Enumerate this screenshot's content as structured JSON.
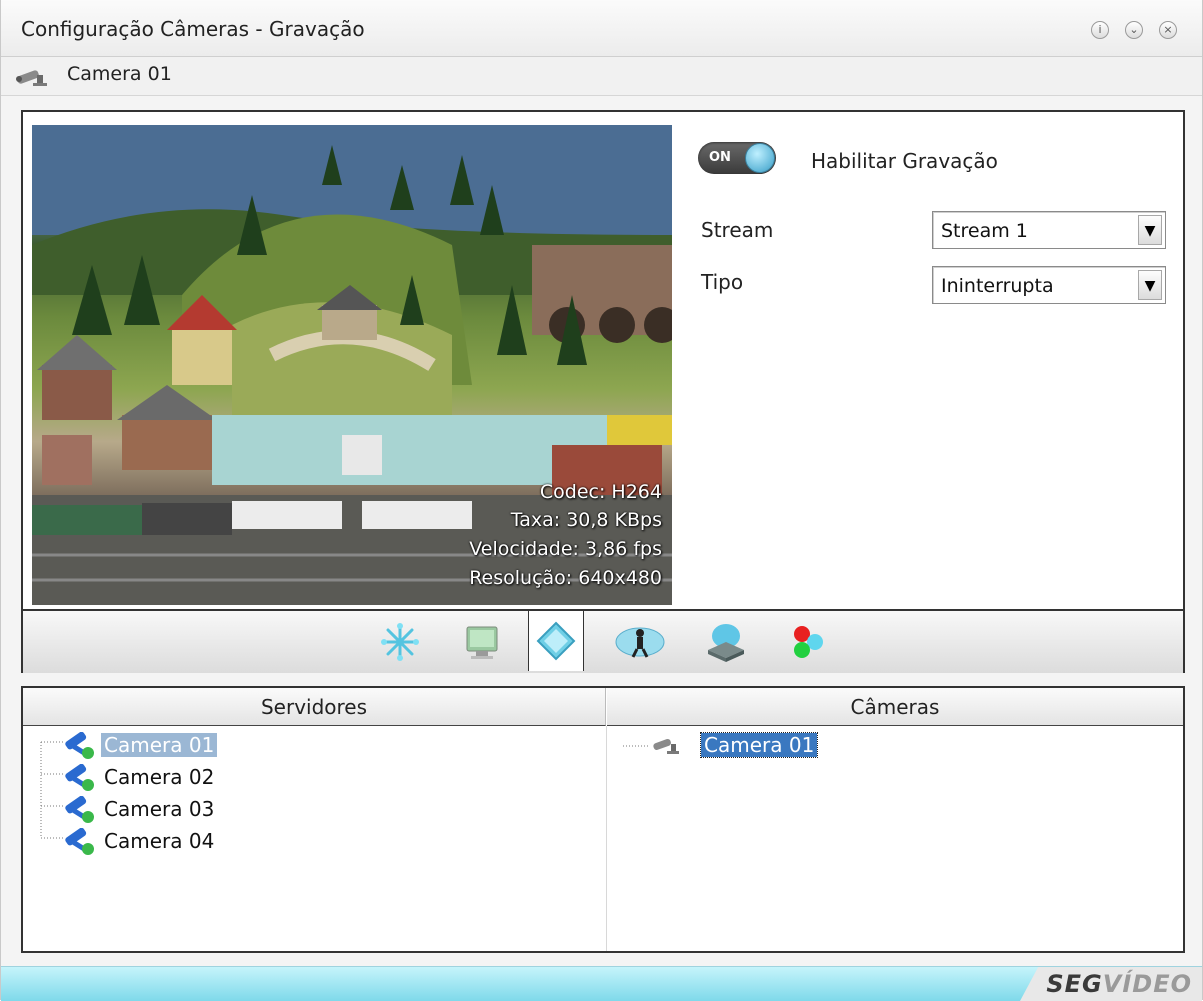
{
  "window": {
    "title": "Configuração Câmeras - Gravação",
    "buttons": [
      "info",
      "minimize",
      "close"
    ]
  },
  "camera_header": {
    "label": "Camera 01",
    "icon": "security-camera-icon"
  },
  "video": {
    "overlay": {
      "codec": "Codec: H264",
      "rate": "Taxa: 30,8 KBps",
      "speed": "Velocidade: 3,86 fps",
      "resolution": "Resolução: 640x480"
    }
  },
  "recording": {
    "toggle_text": "ON",
    "toggle_state": "on",
    "enable_label": "Habilitar Gravação",
    "stream_label": "Stream",
    "stream_value": "Stream 1",
    "type_label": "Tipo",
    "type_value": "Ininterrupta"
  },
  "toolbar": {
    "tools": [
      "asterisk-icon",
      "monitor-icon",
      "layer-icon",
      "motion-sensor-icon",
      "database-icon",
      "color-dots-icon"
    ],
    "active_index": 2
  },
  "servers": {
    "header": "Servidores",
    "items": [
      "Camera 01",
      "Camera 02",
      "Camera 03",
      "Camera 04"
    ],
    "selected_index": 0
  },
  "cameras": {
    "header": "Câmeras",
    "items": [
      "Camera 01"
    ],
    "selected_index": 0
  },
  "footer": {
    "brand_part1": "SEG",
    "brand_part2": "VÍDEO"
  },
  "colors": {
    "footer_gradient_top": "#c5f4fb",
    "footer_gradient_bottom": "#7fd9ea",
    "selection_blue": "#3a78c0",
    "selection_pale": "#9bb7d4"
  }
}
